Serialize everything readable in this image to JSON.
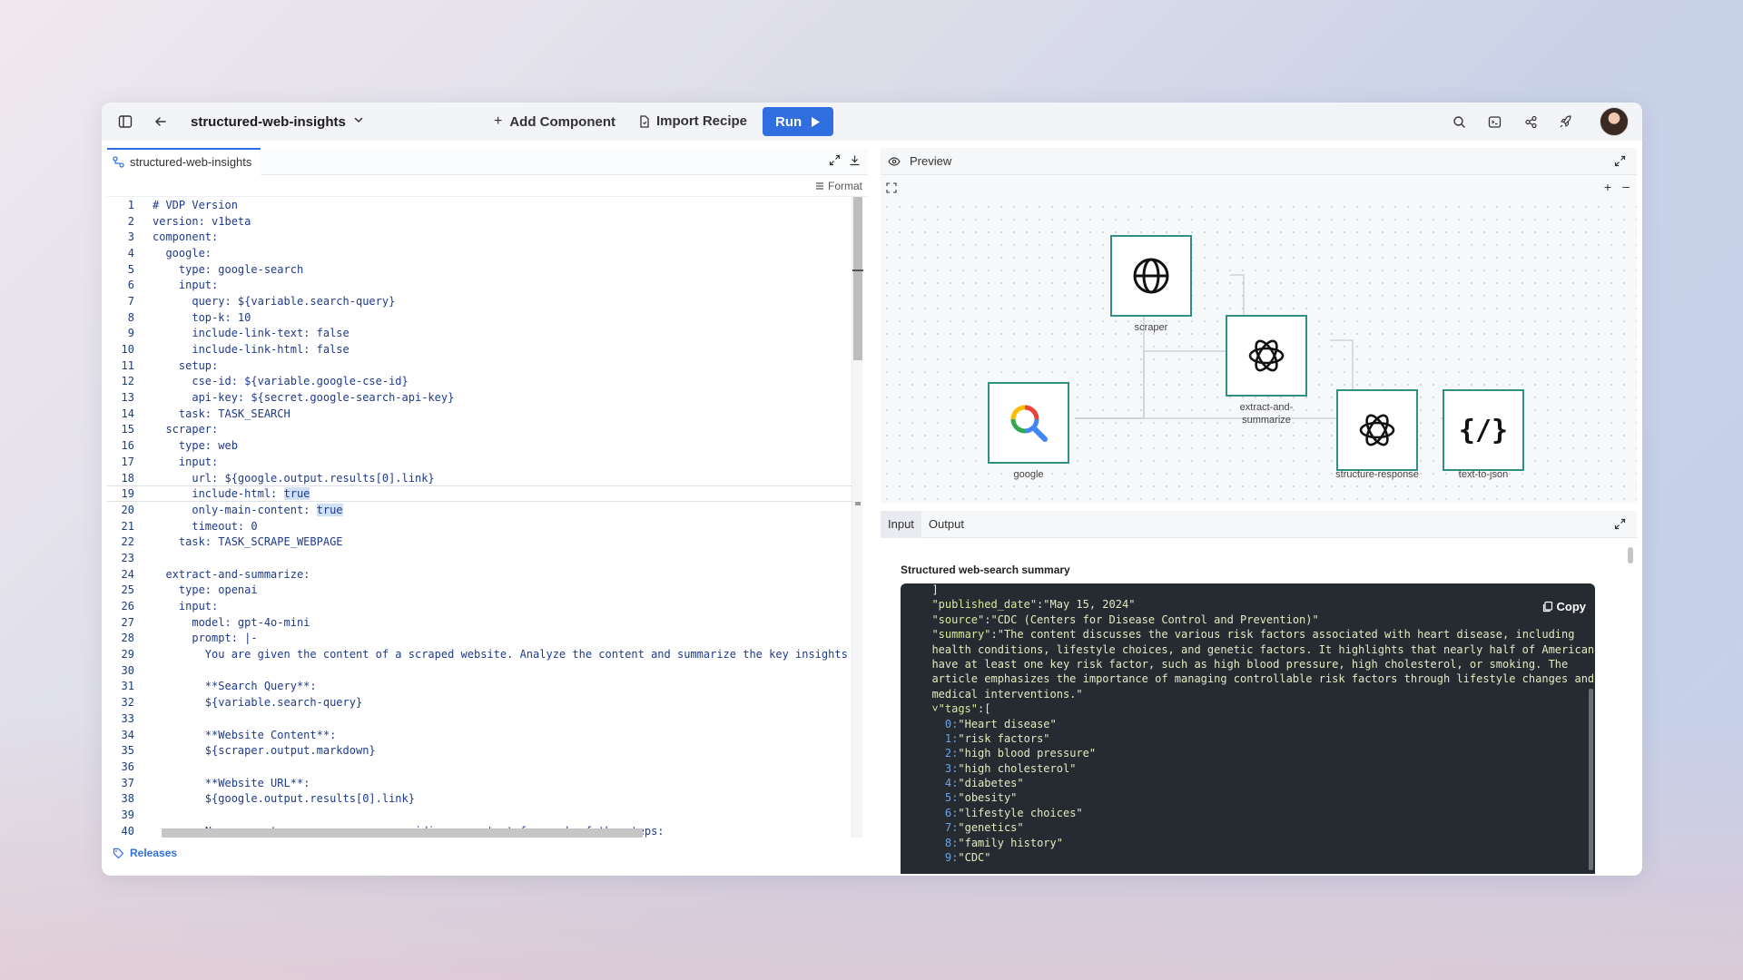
{
  "topbar": {
    "project_title": "structured-web-insights",
    "add_component": "Add Component",
    "import_recipe": "Import Recipe",
    "run": "Run"
  },
  "editor": {
    "file_tab": "structured-web-insights",
    "format_label": "Format",
    "releases_label": "Releases",
    "lines": [
      {
        "n": "1",
        "text": "# VDP Version"
      },
      {
        "n": "2",
        "text": "version: v1beta"
      },
      {
        "n": "3",
        "text": "component:"
      },
      {
        "n": "4",
        "text": "  google:"
      },
      {
        "n": "5",
        "text": "    type: google-search"
      },
      {
        "n": "6",
        "text": "    input:"
      },
      {
        "n": "7",
        "text": "      query: ${variable.search-query}"
      },
      {
        "n": "8",
        "text": "      top-k: 10"
      },
      {
        "n": "9",
        "text": "      include-link-text: false"
      },
      {
        "n": "10",
        "text": "      include-link-html: false"
      },
      {
        "n": "11",
        "text": "    setup:"
      },
      {
        "n": "12",
        "text": "      cse-id: ${variable.google-cse-id}"
      },
      {
        "n": "13",
        "text": "      api-key: ${secret.google-search-api-key}"
      },
      {
        "n": "14",
        "text": "    task: TASK_SEARCH"
      },
      {
        "n": "15",
        "text": "  scraper:"
      },
      {
        "n": "16",
        "text": "    type: web"
      },
      {
        "n": "17",
        "text": "    input:"
      },
      {
        "n": "18",
        "text": "      url: ${google.output.results[0].link}"
      },
      {
        "n": "19",
        "text": "      include-html: ",
        "hl": "true"
      },
      {
        "n": "20",
        "text": "      only-main-content: ",
        "hl": "true"
      },
      {
        "n": "21",
        "text": "      timeout: 0"
      },
      {
        "n": "22",
        "text": "    task: TASK_SCRAPE_WEBPAGE"
      },
      {
        "n": "23",
        "text": ""
      },
      {
        "n": "24",
        "text": "  extract-and-summarize:"
      },
      {
        "n": "25",
        "text": "    type: openai"
      },
      {
        "n": "26",
        "text": "    input:"
      },
      {
        "n": "27",
        "text": "      model: gpt-4o-mini"
      },
      {
        "n": "28",
        "text": "      prompt: |-"
      },
      {
        "n": "29",
        "text": "        You are given the content of a scraped website. Analyze the content and summarize the key insights tha"
      },
      {
        "n": "30",
        "text": ""
      },
      {
        "n": "31",
        "text": "        **Search Query**:"
      },
      {
        "n": "32",
        "text": "        ${variable.search-query}"
      },
      {
        "n": "33",
        "text": ""
      },
      {
        "n": "34",
        "text": "        **Website Content**:"
      },
      {
        "n": "35",
        "text": "        ${scraper.output.markdown}"
      },
      {
        "n": "36",
        "text": ""
      },
      {
        "n": "37",
        "text": "        **Website URL**:"
      },
      {
        "n": "38",
        "text": "        ${google.output.results[0].link}"
      },
      {
        "n": "39",
        "text": ""
      },
      {
        "n": "40",
        "text": "        Now generate your response, providing an output for each of the steps:"
      }
    ]
  },
  "preview": {
    "tab_label": "Preview",
    "nodes": [
      {
        "id": "scraper",
        "label": "scraper"
      },
      {
        "id": "extract",
        "label": "extract-and-\nsummarize"
      },
      {
        "id": "google",
        "label": "google"
      },
      {
        "id": "structure",
        "label": "structure-response"
      },
      {
        "id": "textjson",
        "label": "text-to-json",
        "glyph": "{/}"
      }
    ]
  },
  "io": {
    "input_tab": "Input",
    "output_tab": "Output",
    "summary_title": "Structured web-search summary",
    "copy_label": "Copy",
    "json_lines": [
      {
        "indent": "  ",
        "text": "]"
      },
      {
        "indent": "  ",
        "k": "\"published_date\"",
        "v": "\"May 15, 2024\""
      },
      {
        "indent": "  ",
        "k": "\"source\"",
        "v": "\"CDC (Centers for Disease Control and Prevention)\""
      },
      {
        "indent": "  ",
        "k": "\"summary\"",
        "v": "\"The content discusses the various risk factors associated with heart disease, including"
      },
      {
        "indent": "  ",
        "v": "health conditions, lifestyle choices, and genetic factors. It highlights that nearly half of Americans"
      },
      {
        "indent": "  ",
        "v": "have at least one key risk factor, such as high blood pressure, high cholesterol, or smoking. The"
      },
      {
        "indent": "  ",
        "v": "article emphasizes the importance of managing controllable risk factors through lifestyle changes and"
      },
      {
        "indent": "  ",
        "v": "medical interventions.\""
      },
      {
        "indent": "  ",
        "k": "˅\"tags\"",
        "v": "["
      },
      {
        "indent": "    ",
        "idx": "0",
        "v": "\"Heart disease\""
      },
      {
        "indent": "    ",
        "idx": "1",
        "v": "\"risk factors\""
      },
      {
        "indent": "    ",
        "idx": "2",
        "v": "\"high blood pressure\""
      },
      {
        "indent": "    ",
        "idx": "3",
        "v": "\"high cholesterol\""
      },
      {
        "indent": "    ",
        "idx": "4",
        "v": "\"diabetes\""
      },
      {
        "indent": "    ",
        "idx": "5",
        "v": "\"obesity\""
      },
      {
        "indent": "    ",
        "idx": "6",
        "v": "\"lifestyle choices\""
      },
      {
        "indent": "    ",
        "idx": "7",
        "v": "\"genetics\""
      },
      {
        "indent": "    ",
        "idx": "8",
        "v": "\"family history\""
      },
      {
        "indent": "    ",
        "idx": "9",
        "v": "\"CDC\""
      }
    ]
  },
  "colors": {
    "accent": "#316fe0",
    "node_border": "#2f8f83",
    "json_bg": "#262b32"
  }
}
